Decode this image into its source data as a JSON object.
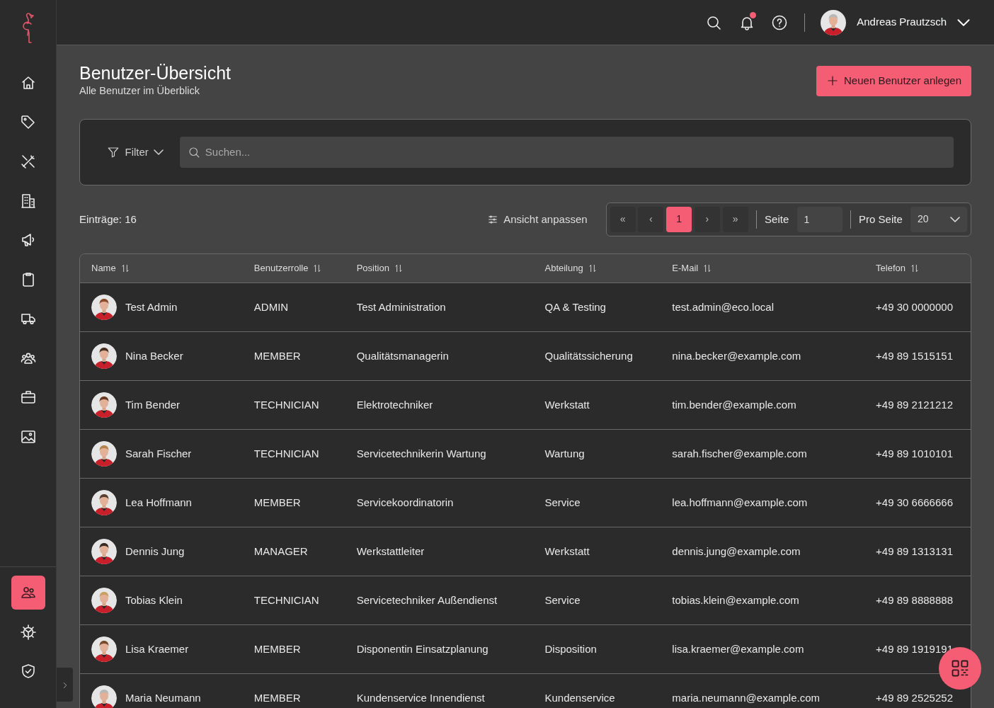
{
  "sidebar": {
    "items": [
      {
        "selected": false
      },
      {
        "selected": false
      },
      {
        "selected": false
      },
      {
        "selected": false
      },
      {
        "selected": false
      },
      {
        "selected": false
      },
      {
        "selected": false
      },
      {
        "selected": false
      },
      {
        "selected": false
      },
      {
        "selected": false
      }
    ],
    "bottom_items": [
      {
        "selected": true
      },
      {
        "selected": false
      },
      {
        "selected": false
      }
    ]
  },
  "topbar": {
    "unread_notifications": true,
    "user": {
      "name": "Andreas Prautzsch"
    }
  },
  "header": {
    "title": "Benutzer-Übersicht",
    "subtitle": "Alle Benutzer im Überblick",
    "primary_button": "Neuen Benutzer anlegen"
  },
  "filter": {
    "label": "Filter",
    "search_placeholder": "Suchen..."
  },
  "toolbar": {
    "entries": "Einträge: 16",
    "view_button": "Ansicht anpassen",
    "pagination": {
      "pages": [
        {
          "label": "«",
          "selected": false
        },
        {
          "label": "‹",
          "selected": false
        },
        {
          "label": "1",
          "selected": true
        },
        {
          "label": "›",
          "selected": false
        },
        {
          "label": "»",
          "selected": false
        }
      ],
      "page_label": "Seite",
      "page_value": "1",
      "per_page_label": "Pro Seite",
      "per_page_value": "20"
    }
  },
  "table": {
    "columns": [
      "Name",
      "Benutzerrolle",
      "Position",
      "Abteilung",
      "E-Mail",
      "Telefon"
    ],
    "rows": [
      {
        "name": "Test Admin",
        "role": "ADMIN",
        "position": "Test Administration",
        "department": "QA & Testing",
        "email": "test.admin@eco.local",
        "phone": "+49 30 0000000"
      },
      {
        "name": "Nina Becker",
        "role": "MEMBER",
        "position": "Qualitätsmanagerin",
        "department": "Qualitätssicherung",
        "email": "nina.becker@example.com",
        "phone": "+49 89 1515151"
      },
      {
        "name": "Tim Bender",
        "role": "TECHNICIAN",
        "position": "Elektrotechniker",
        "department": "Werkstatt",
        "email": "tim.bender@example.com",
        "phone": "+49 89 2121212"
      },
      {
        "name": "Sarah Fischer",
        "role": "TECHNICIAN",
        "position": "Servicetechnikerin Wartung",
        "department": "Wartung",
        "email": "sarah.fischer@example.com",
        "phone": "+49 89 1010101"
      },
      {
        "name": "Lea Hoffmann",
        "role": "MEMBER",
        "position": "Servicekoordinatorin",
        "department": "Service",
        "email": "lea.hoffmann@example.com",
        "phone": "+49 30 6666666"
      },
      {
        "name": "Dennis Jung",
        "role": "MANAGER",
        "position": "Werkstattleiter",
        "department": "Werkstatt",
        "email": "dennis.jung@example.com",
        "phone": "+49 89 1313131"
      },
      {
        "name": "Tobias Klein",
        "role": "TECHNICIAN",
        "position": "Servicetechniker Außendienst",
        "department": "Service",
        "email": "tobias.klein@example.com",
        "phone": "+49 89 8888888"
      },
      {
        "name": "Lisa Kraemer",
        "role": "MEMBER",
        "position": "Disponentin Einsatzplanung",
        "department": "Disposition",
        "email": "lisa.kraemer@example.com",
        "phone": "+49 89 1919191"
      },
      {
        "name": "Maria Neumann",
        "role": "MEMBER",
        "position": "Kundenservice Innendienst",
        "department": "Kundenservice",
        "email": "maria.neumann@example.com",
        "phone": "+49 89 2525252"
      }
    ]
  }
}
